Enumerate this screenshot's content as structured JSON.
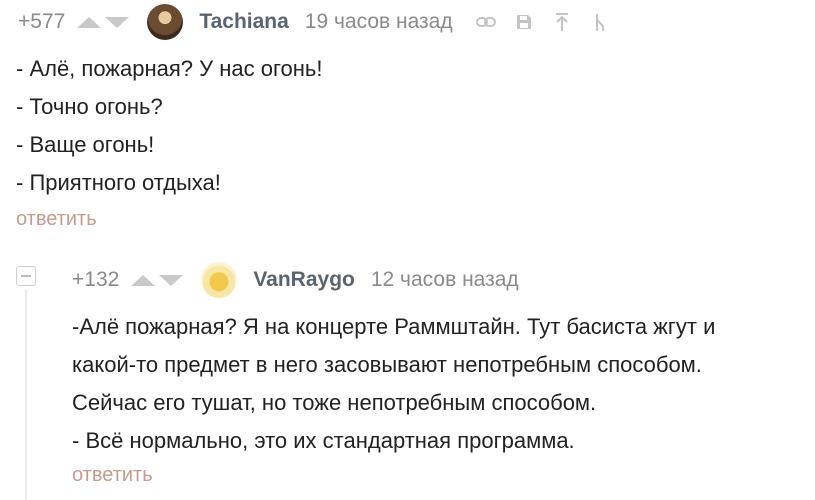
{
  "comments": [
    {
      "rating": "+577",
      "username": "Tachiana",
      "time": "19 часов назад",
      "avatar_icon": "user-avatar-photo",
      "lines": [
        "- Алё, пожарная? У нас огонь!",
        "- Точно огонь?",
        "- Ваще огонь!",
        "- Приятного отдыха!"
      ],
      "reply_label": "ответить",
      "tools": [
        "link-icon",
        "save-icon",
        "scroll-up-icon",
        "branch-icon"
      ]
    },
    {
      "rating": "+132",
      "username": "VanRaygo",
      "time": "12 часов назад",
      "avatar_icon": "user-avatar-emoji",
      "lines": [
        "-Алё пожарная? Я на концерте Раммштайн. Тут басиста жгут и",
        "какой-то предмет в него засовывают непотребным способом.",
        "Сейчас его тушат, но тоже непотребным способом.",
        "- Всё нормально, это их стандартная программа."
      ],
      "reply_label": "ответить"
    }
  ],
  "colors": {
    "reply_link": "#c79a90",
    "username": "#5a6470",
    "meta": "#8a8a8a",
    "vote_arrow": "#c9c9c9"
  }
}
